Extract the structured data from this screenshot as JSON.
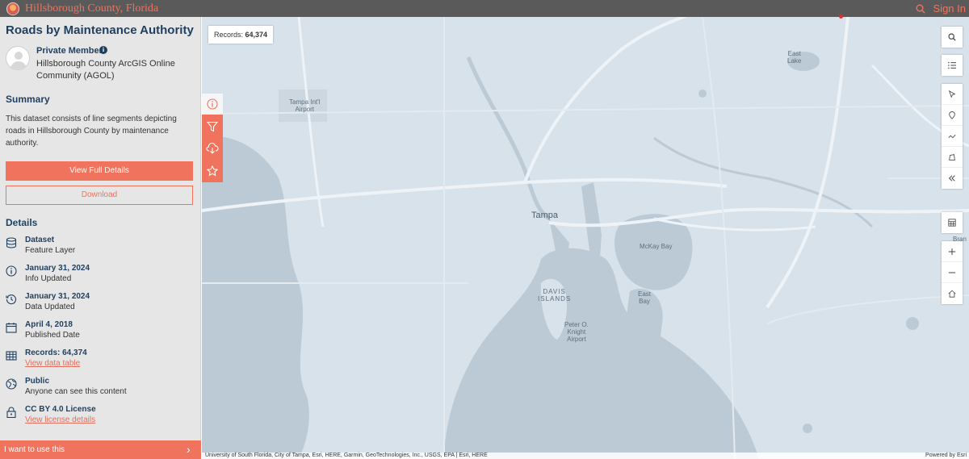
{
  "header": {
    "site_title": "Hillsborough County, Florida",
    "sign_in": "Sign In",
    "icons": [
      "logo",
      "search-icon"
    ]
  },
  "dataset": {
    "title": "Roads by Maintenance Authority",
    "owner_name": "Private Member",
    "owner_org": "Hillsborough County ArcGIS Online Community (AGOL)"
  },
  "summary": {
    "heading": "Summary",
    "text": "This dataset consists of line segments depicting roads in Hillsborough County by maintenance authority."
  },
  "buttons": {
    "view_full_details": "View Full Details",
    "download": "Download"
  },
  "details": {
    "heading": "Details",
    "items": [
      {
        "title": "Dataset",
        "sub": "Feature Layer",
        "icon": "layers-icon"
      },
      {
        "title": "January 31, 2024",
        "sub": "Info Updated",
        "icon": "info-icon"
      },
      {
        "title": "January 31, 2024",
        "sub": "Data Updated",
        "icon": "history-icon"
      },
      {
        "title": "April 4, 2018",
        "sub": "Published Date",
        "icon": "calendar-icon"
      },
      {
        "title": "Records: 64,374",
        "sub": "View data table",
        "icon": "table-icon"
      },
      {
        "title": "Public",
        "sub": "Anyone can see this content",
        "icon": "globe-icon"
      },
      {
        "title": "CC BY 4.0 License",
        "sub": "View license details",
        "icon": "lock-icon"
      }
    ]
  },
  "use_bar": {
    "label": "I want to use this"
  },
  "map": {
    "records_label": "Records:",
    "records_value": "64,374",
    "labels": {
      "tampa": "Tampa",
      "mckay_bay": "McKay Bay",
      "east_bay": "East\nBay",
      "davis_islands": "DAVIS\nISLANDS",
      "airport": "Tampa Int'l\nAirport",
      "knight_airport": "Peter O.\nKnight\nAirport",
      "east_lake": "East\nLake",
      "brandon": "Bran"
    },
    "attribution": "University of South Florida, City of Tampa, Esri, HERE, Garmin, GeoTechnologies, Inc., USGS, EPA | Esri, HERE",
    "powered_by": "Powered by Esri"
  },
  "colors": {
    "accent": "#f0735e",
    "title_blue": "#1f3f5f",
    "topbar": "#5a5a5a",
    "water": "#bccad5",
    "land": "#d8e2ea"
  }
}
